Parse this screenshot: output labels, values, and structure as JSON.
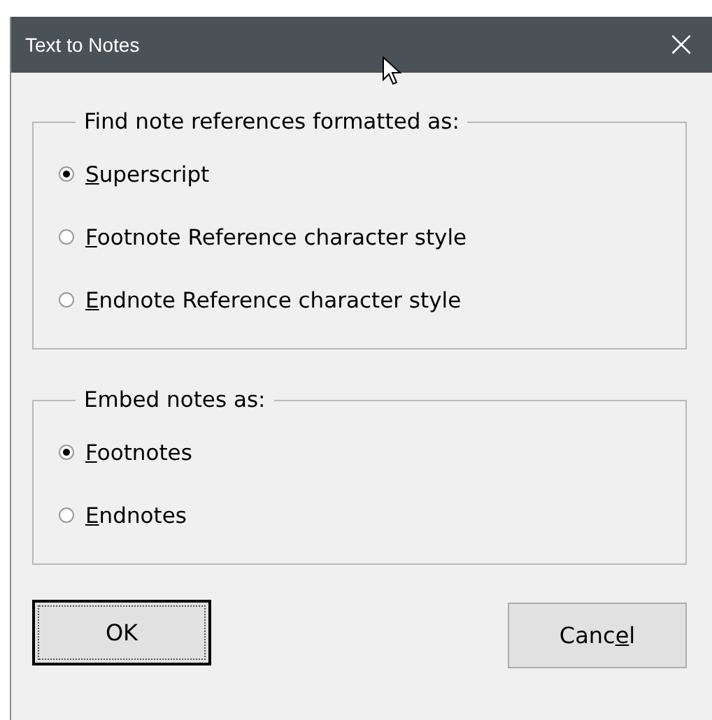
{
  "window": {
    "title": "Text to Notes",
    "close": "×"
  },
  "groups": [
    {
      "legend": "Find note references formatted as:",
      "options": [
        {
          "access_key": "S",
          "text_after": "uperscript",
          "selected": true
        },
        {
          "access_key": "F",
          "text_after": "ootnote Reference character style",
          "selected": false
        },
        {
          "access_key": "E",
          "text_after": "ndnote Reference character style",
          "selected": false
        }
      ]
    },
    {
      "legend": "Embed notes as:",
      "options": [
        {
          "access_key": "F",
          "text_after": "ootnotes",
          "selected": true
        },
        {
          "access_key": "E",
          "text_after": "ndnotes",
          "selected": false
        }
      ]
    }
  ],
  "buttons": [
    {
      "text_before": "OK",
      "default": true
    },
    {
      "text_before": "Canc",
      "access_key": "e",
      "text_after": "l",
      "default": false
    }
  ]
}
